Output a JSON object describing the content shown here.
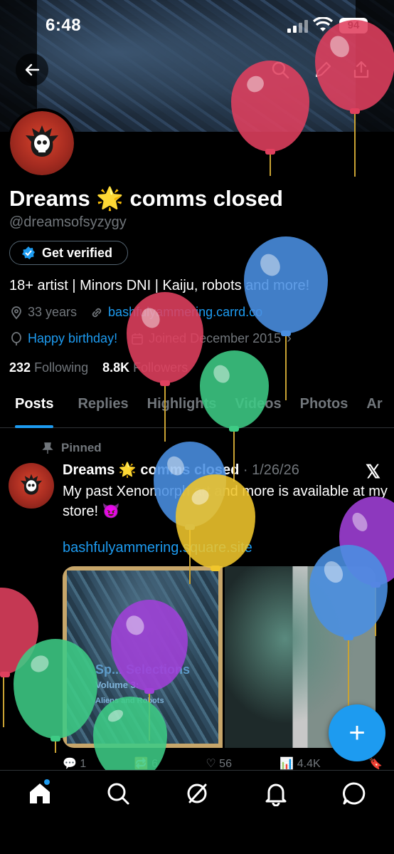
{
  "status": {
    "time": "6:48",
    "battery": "94"
  },
  "profile": {
    "display_name": "Dreams 🌟 comms closed",
    "handle": "@dreamsofsyzygy",
    "verify_label": "Get verified",
    "bio": "18+ artist | Minors DNI | Kaiju, robots and more!",
    "age": "33 years",
    "website": "bashfulyammering.carrd.co",
    "birthday": "Happy birthday!",
    "joined": "Joined December 2015",
    "following_count": "232",
    "following_label": "Following",
    "followers_count": "8.8K",
    "followers_label": "Followers"
  },
  "tabs": [
    {
      "label": "Posts"
    },
    {
      "label": "Replies"
    },
    {
      "label": "Highlights"
    },
    {
      "label": "Videos"
    },
    {
      "label": "Photos"
    },
    {
      "label": "Ar"
    }
  ],
  "post": {
    "pinned_label": "Pinned",
    "author": "Dreams 🌟 comms closed",
    "date": "· 1/26/26",
    "text": "My past Xenomorph art and more is available at my store! 😈",
    "link": "bashfulyammering.square.site",
    "media_title_1": "Sp... Selections",
    "media_title_2": "Volume 3:",
    "media_title_3": "Aliens and Robots",
    "replies": "1",
    "reposts": "6",
    "likes": "56",
    "views": "4.4K"
  },
  "fab_label": "+",
  "colors": {
    "accent": "#1d9bf0",
    "background": "#000000",
    "muted": "#71767b"
  },
  "icons": [
    "back-arrow-icon",
    "search-icon",
    "edit-icon",
    "share-icon",
    "home-icon",
    "grok-icon",
    "bell-icon",
    "messages-icon"
  ]
}
